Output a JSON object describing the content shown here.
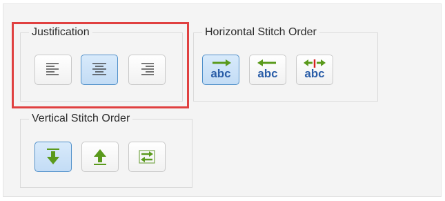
{
  "groups": {
    "justification": {
      "title": "Justification",
      "buttons": [
        {
          "name": "align-left",
          "selected": false
        },
        {
          "name": "align-center",
          "selected": true
        },
        {
          "name": "align-right",
          "selected": false
        }
      ]
    },
    "horizontal": {
      "title": "Horizontal Stitch Order",
      "abc": "abc",
      "buttons": [
        {
          "name": "left-to-right",
          "selected": true
        },
        {
          "name": "right-to-left",
          "selected": false
        },
        {
          "name": "center-out",
          "selected": false
        }
      ]
    },
    "vertical": {
      "title": "Vertical Stitch Order",
      "buttons": [
        {
          "name": "top-to-bottom",
          "selected": true
        },
        {
          "name": "bottom-to-top",
          "selected": false
        },
        {
          "name": "alternate",
          "selected": false
        }
      ]
    }
  },
  "colors": {
    "highlight": "#e04040",
    "selected_fill": "#c8e0f8",
    "selected_border": "#4f8fc9",
    "arrow_green": "#5a9a1c",
    "abc_blue": "#2b5ea8",
    "center_red": "#d62020"
  }
}
